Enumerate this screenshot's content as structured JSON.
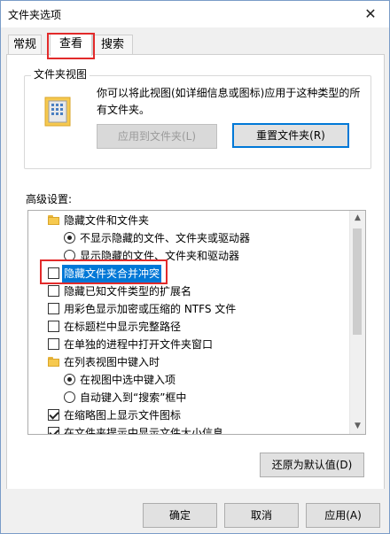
{
  "window": {
    "title": "文件夹选项",
    "close_glyph": "✕"
  },
  "tabs": [
    {
      "label": "常规",
      "active": false
    },
    {
      "label": "查看",
      "active": true
    },
    {
      "label": "搜索",
      "active": false
    }
  ],
  "folder_view": {
    "title": "文件夹视图",
    "description": "你可以将此视图(如详细信息或图标)应用于这种类型的所有文件夹。",
    "apply_button": "应用到文件夹(L)",
    "reset_button": "重置文件夹(R)"
  },
  "advanced": {
    "label": "高级设置:",
    "items": [
      {
        "kind": "folder",
        "label": "隐藏文件和文件夹",
        "checked": false,
        "selected": false
      },
      {
        "kind": "radio",
        "label": "不显示隐藏的文件、文件夹或驱动器",
        "checked": true,
        "selected": false
      },
      {
        "kind": "radio",
        "label": "显示隐藏的文件、文件夹和驱动器",
        "checked": false,
        "selected": false
      },
      {
        "kind": "checkbox",
        "label": "隐藏文件夹合并冲突",
        "checked": false,
        "selected": true
      },
      {
        "kind": "checkbox",
        "label": "隐藏已知文件类型的扩展名",
        "checked": false,
        "selected": false
      },
      {
        "kind": "checkbox",
        "label": "用彩色显示加密或压缩的 NTFS 文件",
        "checked": false,
        "selected": false
      },
      {
        "kind": "checkbox",
        "label": "在标题栏中显示完整路径",
        "checked": false,
        "selected": false
      },
      {
        "kind": "checkbox",
        "label": "在单独的进程中打开文件夹窗口",
        "checked": false,
        "selected": false
      },
      {
        "kind": "folder",
        "label": "在列表视图中键入时",
        "checked": false,
        "selected": false
      },
      {
        "kind": "radio",
        "label": "在视图中选中键入项",
        "checked": true,
        "selected": false
      },
      {
        "kind": "radio",
        "label": "自动键入到“搜索”框中",
        "checked": false,
        "selected": false
      },
      {
        "kind": "checkbox",
        "label": "在缩略图上显示文件图标",
        "checked": true,
        "selected": false
      },
      {
        "kind": "checkbox",
        "label": "在文件夹提示中显示文件大小信息",
        "checked": true,
        "selected": false
      }
    ],
    "restore_button": "还原为默认值(D)"
  },
  "footer": {
    "ok_button": "确定",
    "cancel_button": "取消",
    "apply_button": "应用(A)"
  },
  "colors": {
    "selection": "#0078d7",
    "highlight_annotation": "#e22a2a",
    "folder": "#f6c94f"
  }
}
